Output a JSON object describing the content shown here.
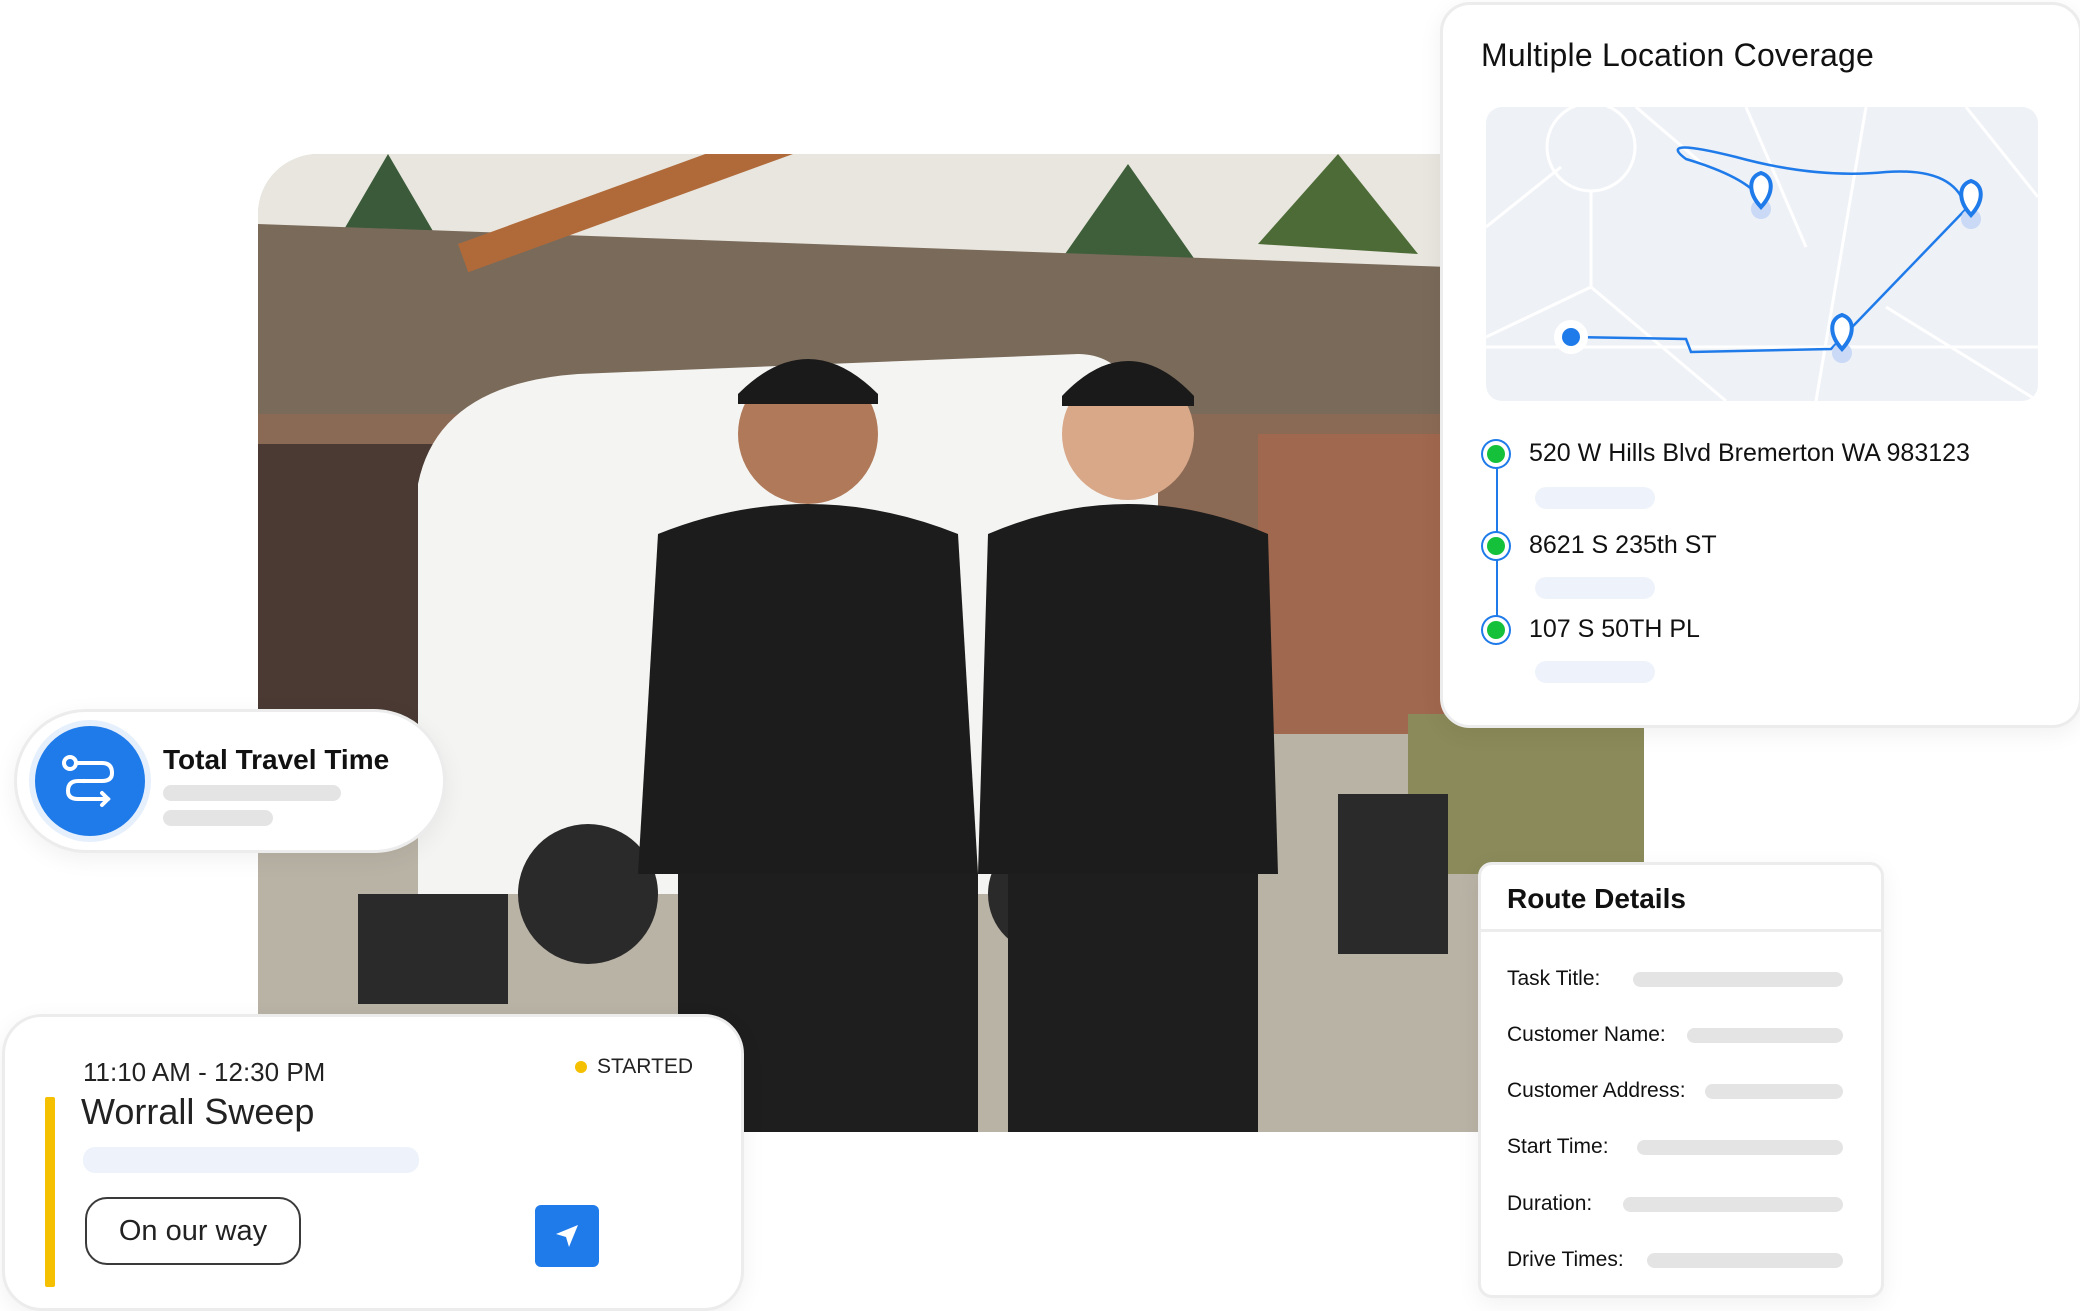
{
  "coverage": {
    "title": "Multiple Location Coverage",
    "locations": [
      {
        "address": "520 W Hills Blvd Bremerton WA 983123"
      },
      {
        "address": "8621 S 235th ST"
      },
      {
        "address": "107 S 50TH PL"
      }
    ]
  },
  "travel": {
    "title": "Total Travel Time",
    "icon": "route-icon"
  },
  "route": {
    "title": "Route Details",
    "fields": [
      {
        "label": "Task Title:"
      },
      {
        "label": "Customer Name:"
      },
      {
        "label": "Customer Address:"
      },
      {
        "label": "Start Time:"
      },
      {
        "label": "Duration:"
      },
      {
        "label": "Drive Times:"
      }
    ]
  },
  "job": {
    "time": "11:10 AM - 12:30 PM",
    "status": "STARTED",
    "name": "Worrall Sweep",
    "button_label": "On our way",
    "send_icon": "send-icon"
  },
  "colors": {
    "accent": "#1f7bea",
    "status": "#f5c000",
    "location_dot": "#15c13a"
  }
}
